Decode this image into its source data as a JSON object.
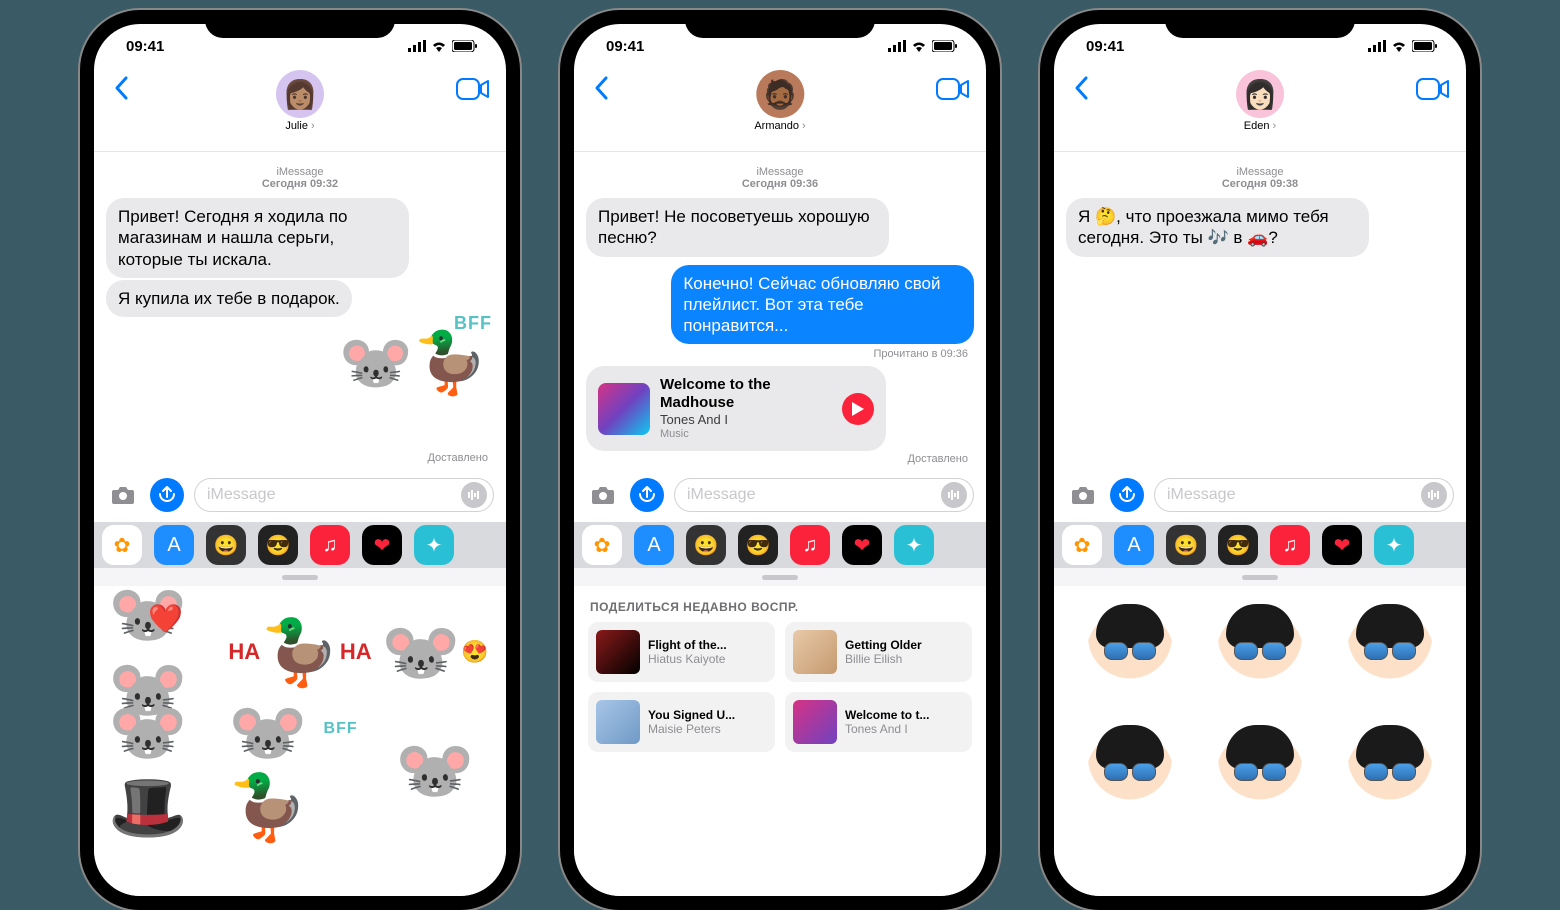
{
  "status": {
    "time": "09:41"
  },
  "placeholders": {
    "imessage": "iMessage"
  },
  "icons": {
    "apps": [
      {
        "name": "photos",
        "bg": "#fff",
        "glyph": "✿",
        "color": "#ff9500"
      },
      {
        "name": "appstore",
        "bg": "#1e8eff",
        "glyph": "A",
        "color": "#fff"
      },
      {
        "name": "memoji1",
        "bg": "#333",
        "glyph": "😀",
        "color": "#fff"
      },
      {
        "name": "memoji2",
        "bg": "#222",
        "glyph": "😎",
        "color": "#fff"
      },
      {
        "name": "music",
        "bg": "#fa233b",
        "glyph": "♫",
        "color": "#fff"
      },
      {
        "name": "fitness",
        "bg": "#000",
        "glyph": "❤",
        "color": "#fa233b"
      },
      {
        "name": "stickers",
        "bg": "#29c0d6",
        "glyph": "✦",
        "color": "#fff"
      }
    ]
  },
  "phones": {
    "julie": {
      "contact": "Julie",
      "avatar_class": "purple",
      "header": {
        "service": "iMessage",
        "ts": "Сегодня 09:32"
      },
      "msgs": [
        "Привет! Сегодня я ходила по магазинам и нашла серьги, которые ты искала.",
        "Я купила их тебе в подарок."
      ],
      "sticker_label": "BFF",
      "receipt": "Доставлено",
      "stickers": {
        "cells": [
          "❤️🐭",
          "HA HA",
          "🐭😍",
          "🐭🕺",
          "BFF",
          "🐭💕"
        ]
      }
    },
    "armando": {
      "contact": "Armando",
      "avatar_class": "brown",
      "header": {
        "service": "iMessage",
        "ts": "Сегодня 09:36"
      },
      "in_msg": "Привет! Не посоветуешь хорошую песню?",
      "out_msg": "Конечно! Сейчас обновляю свой плейлист. Вот эта тебе понравится...",
      "read": "Прочитано в 09:36",
      "music": {
        "title": "Welcome to the Madhouse",
        "artist": "Tones And I",
        "source": "Music"
      },
      "receipt": "Доставлено",
      "share_header": "ПОДЕЛИТЬСЯ НЕДАВНО ВОСПР.",
      "share": [
        {
          "title": "Flight of the...",
          "artist": "Hiatus Kaiyote",
          "bg": "linear-gradient(135deg,#8b1a1a,#000)"
        },
        {
          "title": "Getting Older",
          "artist": "Billie Eilish",
          "bg": "linear-gradient(135deg,#e8c9a8,#c59a6f)"
        },
        {
          "title": "You Signed U...",
          "artist": "Maisie Peters",
          "bg": "linear-gradient(135deg,#a8c5e8,#6f9ac5)"
        },
        {
          "title": "Welcome to t...",
          "artist": "Tones And I",
          "bg": "linear-gradient(135deg,#d63384,#6f42c1)"
        }
      ]
    },
    "eden": {
      "contact": "Eden",
      "avatar_class": "pink",
      "header": {
        "service": "iMessage",
        "ts": "Сегодня 09:38"
      },
      "in_msg": "Я 🤔, что проезжала мимо тебя сегодня. Это ты 🎶 в 🚗?"
    }
  }
}
